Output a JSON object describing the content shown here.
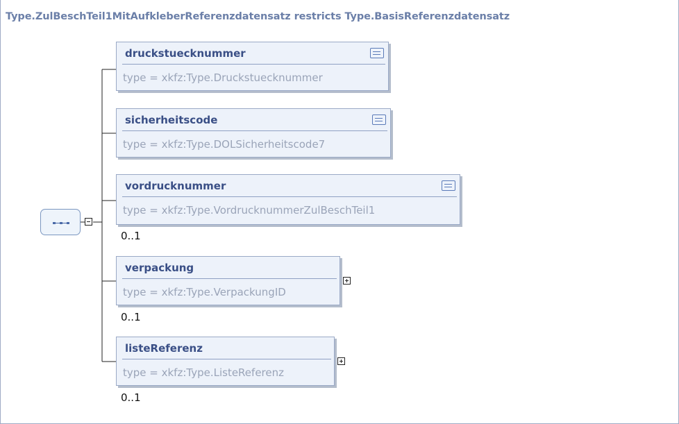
{
  "diagram": {
    "title": "Type.ZulBeschTeil1MitAufkleberReferenzdatensatz restricts Type.BasisReferenzdatensatz",
    "sequence": {
      "icon": "sequence-icon",
      "collapse": "minus-toggle-icon"
    },
    "elements": [
      {
        "name": "druckstuecknummer",
        "type": "type = xkfz:Type.Druckstuecknummer",
        "documented": true,
        "occurs": "",
        "expandable": false
      },
      {
        "name": "sicherheitscode",
        "type": "type = xkfz:Type.DOLSicherheitscode7",
        "documented": true,
        "occurs": "",
        "expandable": false
      },
      {
        "name": "vordrucknummer",
        "type": "type = xkfz:Type.VordrucknummerZulBeschTeil1",
        "documented": true,
        "occurs": "0..1",
        "expandable": false
      },
      {
        "name": "verpackung",
        "type": "type = xkfz:Type.VerpackungID",
        "documented": false,
        "occurs": "0..1",
        "expandable": true
      },
      {
        "name": "listeReferenz",
        "type": "type = xkfz:Type.ListeReferenz",
        "documented": false,
        "occurs": "0..1",
        "expandable": true
      }
    ],
    "colors": {
      "title": "#6b7fa8",
      "name": "#3a4f86",
      "type": "#9aa4b8",
      "box_fill": "#edf2fa",
      "box_border": "#9aa9c6"
    }
  }
}
